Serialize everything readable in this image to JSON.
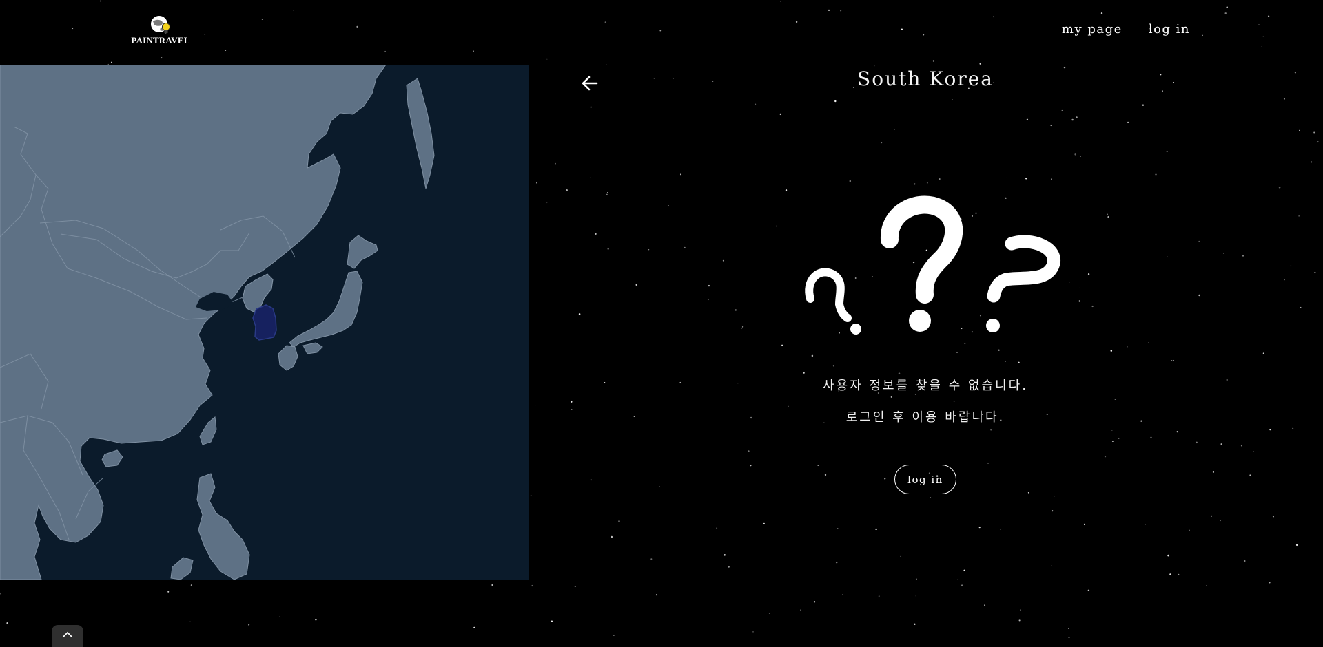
{
  "header": {
    "logo_text": "PAINTRAVEL",
    "nav": [
      {
        "label": "my page"
      },
      {
        "label": "log in"
      }
    ]
  },
  "map": {
    "region": "East Asia",
    "highlighted_country": "South Korea",
    "colors": {
      "ocean": "#0b1b2b",
      "land": "#5e7185",
      "borders": "#8596a8",
      "highlight": "#16215f"
    }
  },
  "panel": {
    "back_icon": "arrow-left-icon",
    "title": "South Korea",
    "illustration": "question-marks",
    "message_line1": "사용자 정보를 찾을 수 없습니다.",
    "message_line2": "로그인 후 이용 바랍니다.",
    "login_button": "log in"
  },
  "scroll_top_icon": "chevron-up-icon"
}
